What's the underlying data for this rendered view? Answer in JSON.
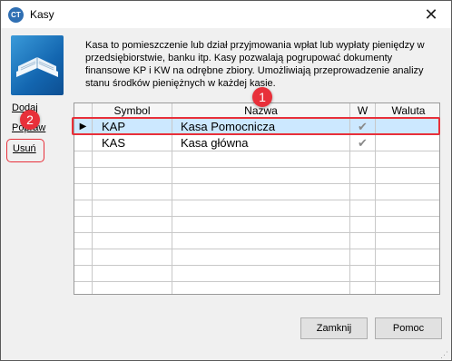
{
  "window": {
    "title": "Kasy",
    "app_icon_text": "CT",
    "close_glyph": "✕"
  },
  "description": "Kasa to pomieszczenie lub dział przyjmowania wpłat lub wypłaty pieniędzy w przedsiębiorstwie, banku itp. Kasy pozwalają pogrupować dokumenty finansowe KP i KW na odrębne zbiory. Umożliwiają przeprowadzenie analizy stanu środków pieniężnych w każdej kasie.",
  "sidebar": {
    "add_label": "Dodaj",
    "edit_label": "Popraw",
    "delete_label": "Usuń"
  },
  "annotations": {
    "badge_1": "1",
    "badge_2": "2"
  },
  "grid": {
    "columns": [
      "",
      "Symbol",
      "Nazwa",
      "W",
      "Waluta"
    ],
    "rows": [
      {
        "indicator": "▶",
        "symbol": "KAP",
        "name": "Kasa Pomocnicza",
        "w": "✔",
        "currency": ""
      },
      {
        "indicator": "",
        "symbol": "KAS",
        "name": "Kasa główna",
        "w": "✔",
        "currency": ""
      }
    ],
    "selected_row": 0
  },
  "buttons": {
    "close_label": "Zamknij",
    "help_label": "Pomoc"
  },
  "colors": {
    "highlight": "#e8303a",
    "selection": "#cce8ff",
    "logo": "#1366b0"
  }
}
